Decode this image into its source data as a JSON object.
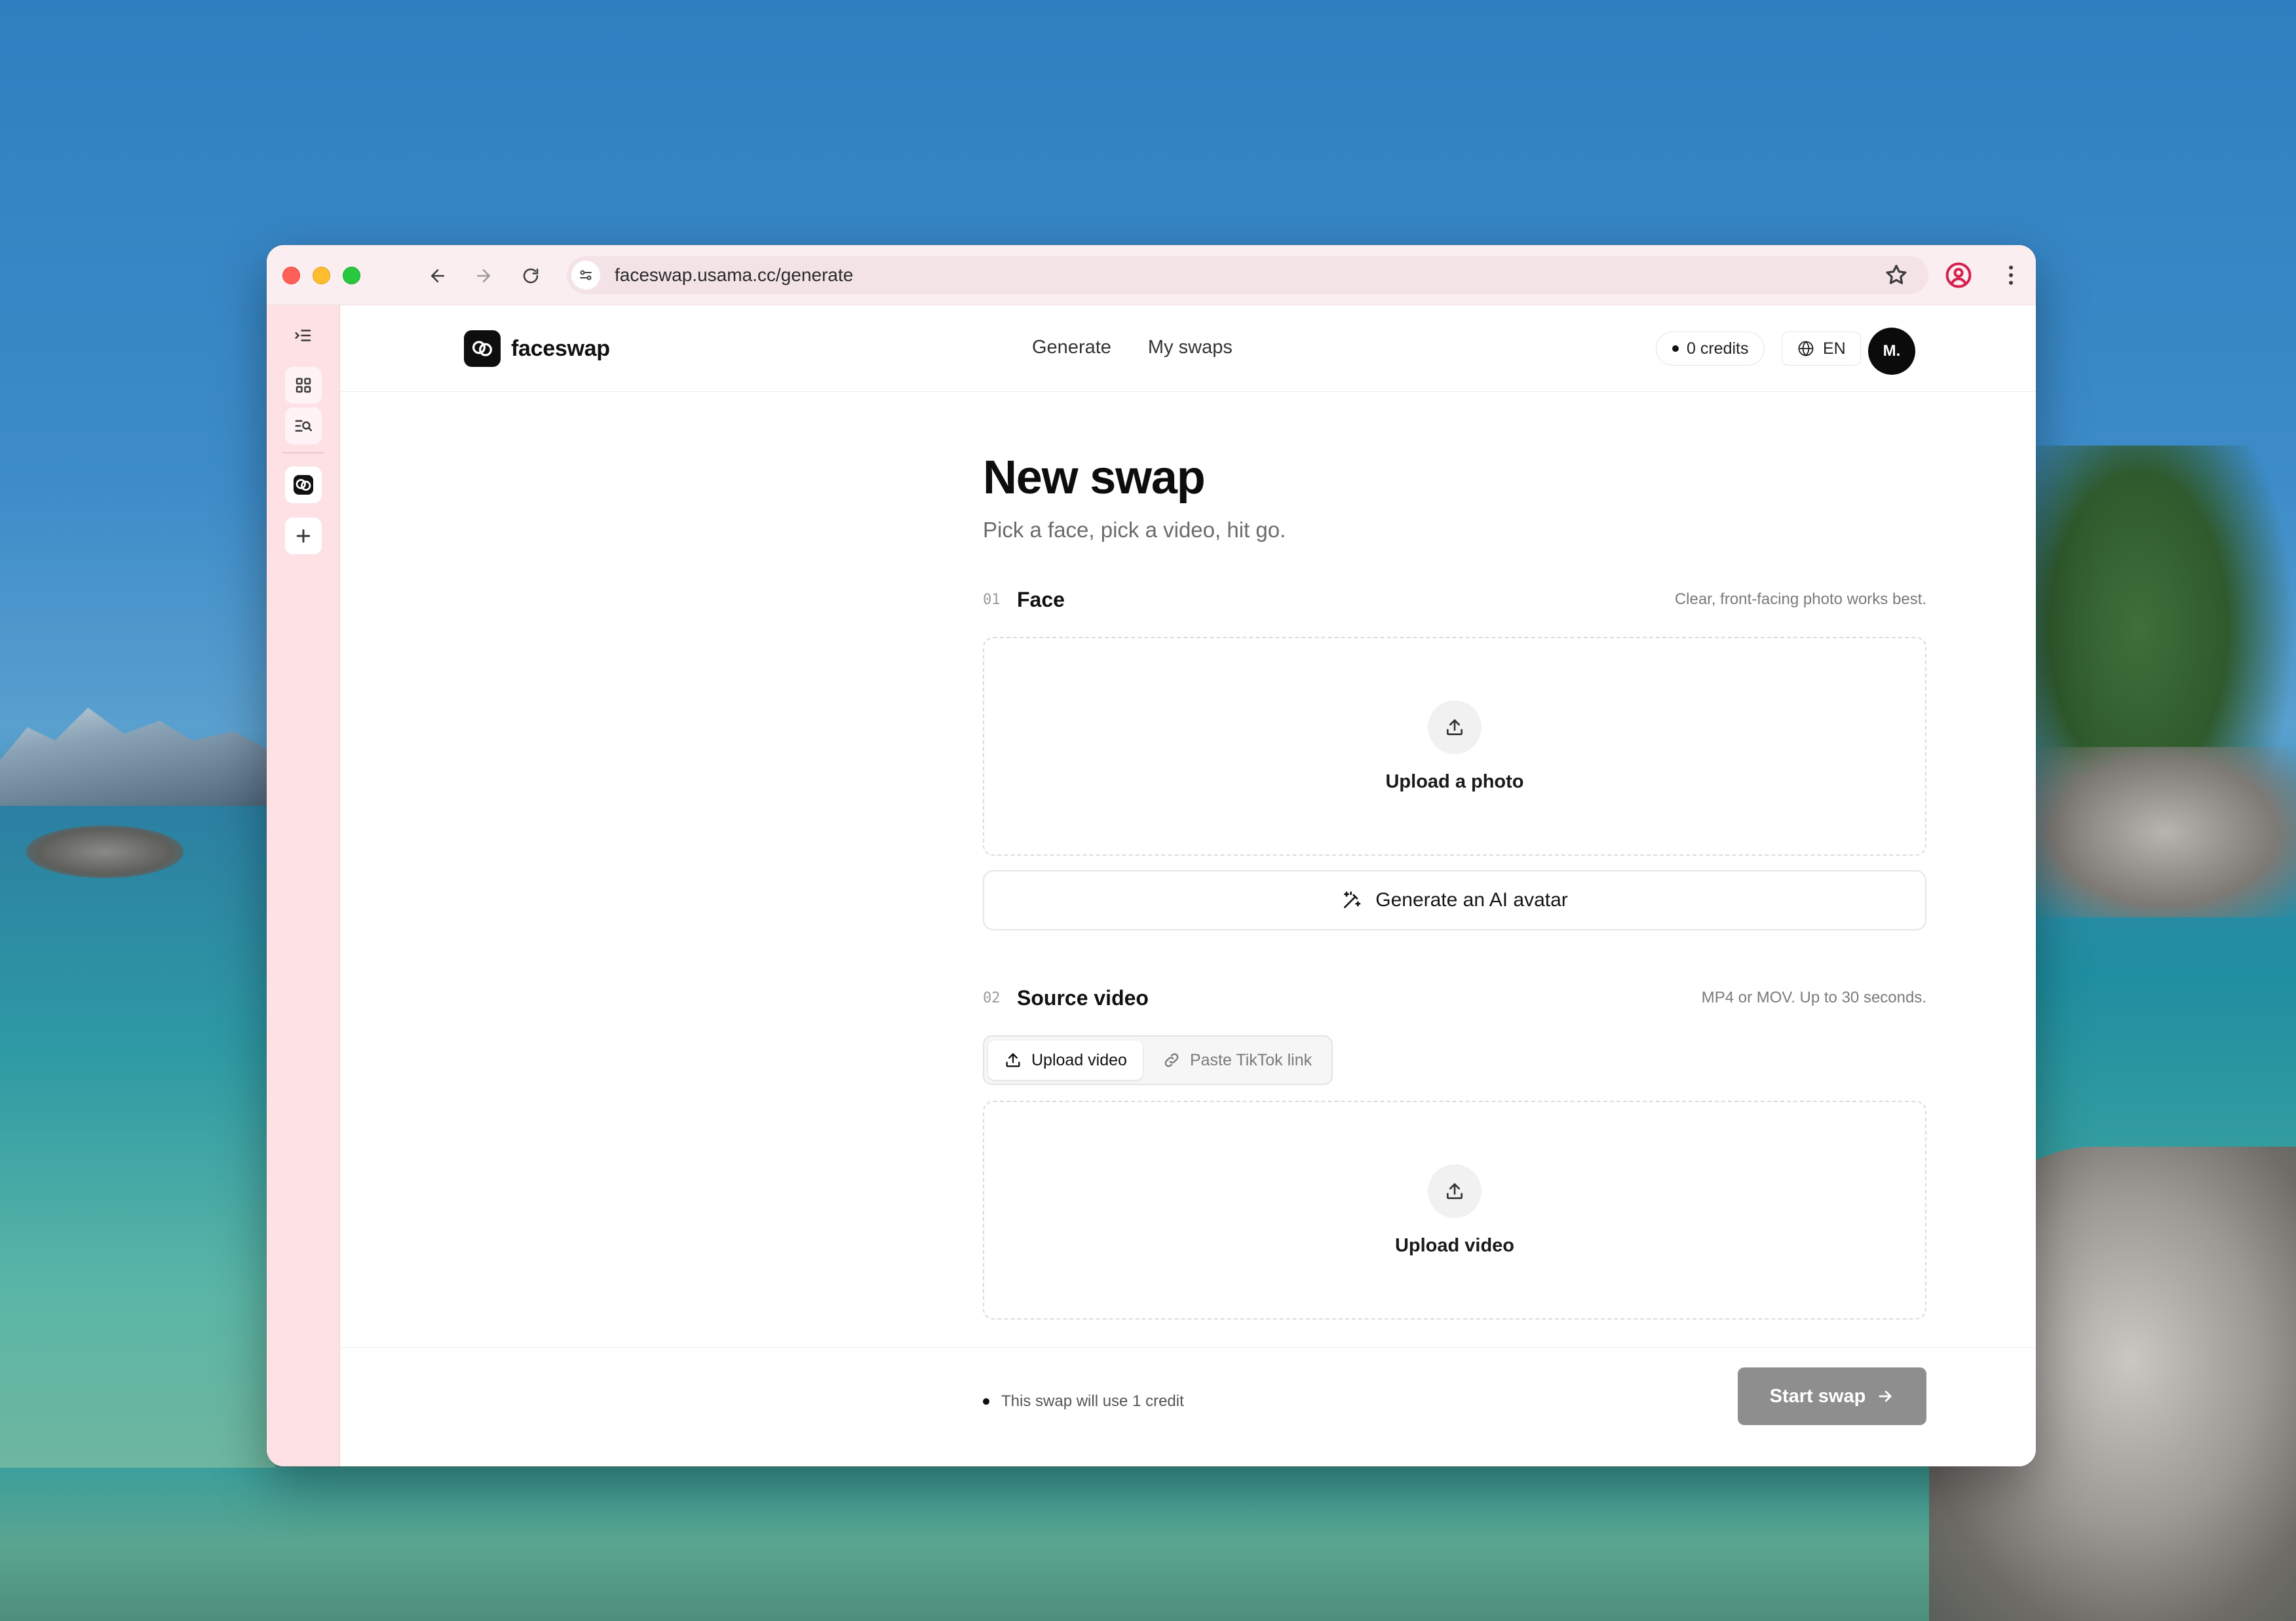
{
  "browser": {
    "url": "faceswap.usama.cc/generate"
  },
  "header": {
    "brand_name": "faceswap",
    "nav": [
      "Generate",
      "My swaps"
    ],
    "credits": "0 credits",
    "language": "EN",
    "avatar_initials": "M."
  },
  "page": {
    "title": "New swap",
    "subtitle": "Pick a face, pick a video, hit go."
  },
  "face_section": {
    "number": "01",
    "title": "Face",
    "hint": "Clear, front-facing photo works best.",
    "upload_label": "Upload a photo",
    "ai_button_label": "Generate an AI avatar"
  },
  "video_section": {
    "number": "02",
    "title": "Source video",
    "hint": "MP4 or MOV. Up to 30 seconds.",
    "tabs": [
      "Upload video",
      "Paste TikTok link"
    ],
    "active_tab": "Upload video",
    "upload_label": "Upload video"
  },
  "footer": {
    "note": "This swap will use 1 credit",
    "start_label": "Start swap"
  },
  "colors": {
    "sidebar_bg": "#fde1e5",
    "titlebar_bg": "#fbeef0",
    "start_button_disabled": "#8e8e8e",
    "brand": "#0e0e0e"
  },
  "icons": {
    "sidebar": [
      "sidebar-toggle-icon",
      "grid-icon",
      "search-list-icon",
      "faceswap-app-icon",
      "plus-icon"
    ],
    "upload": "upload-icon",
    "ai": "magic-wand-icon",
    "link": "link-icon",
    "globe": "globe-icon",
    "arrow": "arrow-right-icon"
  }
}
